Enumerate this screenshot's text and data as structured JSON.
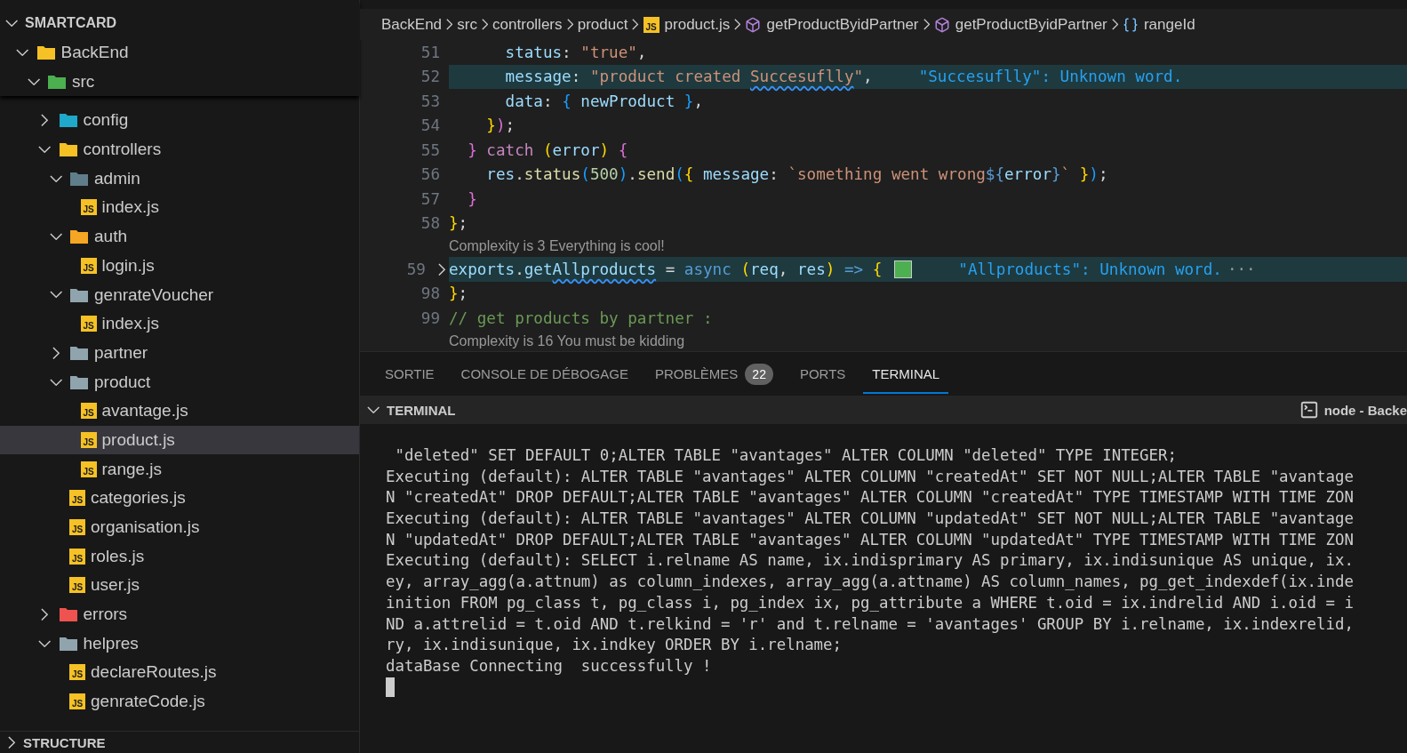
{
  "explorer": {
    "root": {
      "name": "SMARTCARD",
      "expanded": true,
      "children": [
        {
          "name": "BackEnd",
          "kind": "folder",
          "color": "#f5c125",
          "expanded": true,
          "children": [
            {
              "name": "src",
              "kind": "folder",
              "color": "#4caf50",
              "expanded": true,
              "children": [
                {
                  "name": "config",
                  "kind": "folder",
                  "color": "#1fa8c9",
                  "expanded": false,
                  "selected": false
                },
                {
                  "name": "controllers",
                  "kind": "folder",
                  "color": "#f5c125",
                  "expanded": true,
                  "selected": false,
                  "children": [
                    {
                      "name": "admin",
                      "kind": "folder",
                      "color": "#607d8b",
                      "expanded": true,
                      "selected": false,
                      "children": [
                        {
                          "name": "index.js",
                          "kind": "js",
                          "badge": "JS",
                          "selected": false
                        }
                      ]
                    },
                    {
                      "name": "auth",
                      "kind": "folder",
                      "color": "#f5a623",
                      "expanded": true,
                      "selected": false,
                      "children": [
                        {
                          "name": "login.js",
                          "kind": "js",
                          "badge": "JS",
                          "selected": false
                        }
                      ]
                    },
                    {
                      "name": "genrateVoucher",
                      "kind": "folder",
                      "color": "#90a4ae",
                      "expanded": true,
                      "selected": false,
                      "children": [
                        {
                          "name": "index.js",
                          "kind": "js",
                          "badge": "JS",
                          "selected": false
                        }
                      ]
                    },
                    {
                      "name": "partner",
                      "kind": "folder",
                      "color": "#90a4ae",
                      "expanded": false,
                      "selected": false
                    },
                    {
                      "name": "product",
                      "kind": "folder",
                      "color": "#90a4ae",
                      "expanded": true,
                      "selected": false,
                      "children": [
                        {
                          "name": "avantage.js",
                          "kind": "js",
                          "badge": "JS",
                          "selected": false
                        },
                        {
                          "name": "product.js",
                          "kind": "js",
                          "badge": "JS",
                          "selected": true
                        },
                        {
                          "name": "range.js",
                          "kind": "js",
                          "badge": "JS",
                          "selected": false
                        }
                      ]
                    },
                    {
                      "name": "categories.js",
                      "kind": "js",
                      "badge": "JS",
                      "selected": false
                    },
                    {
                      "name": "organisation.js",
                      "kind": "js",
                      "badge": "JS",
                      "selected": false
                    },
                    {
                      "name": "roles.js",
                      "kind": "js",
                      "badge": "JS",
                      "selected": false
                    },
                    {
                      "name": "user.js",
                      "kind": "js",
                      "badge": "JS",
                      "selected": false
                    }
                  ]
                },
                {
                  "name": "errors",
                  "kind": "folder",
                  "color": "#ef5350",
                  "expanded": false,
                  "selected": false
                },
                {
                  "name": "helpres",
                  "kind": "folder",
                  "color": "#90a4ae",
                  "expanded": true,
                  "selected": false,
                  "children": [
                    {
                      "name": "declareRoutes.js",
                      "kind": "js",
                      "badge": "JS",
                      "selected": false
                    },
                    {
                      "name": "genrateCode.js",
                      "kind": "js",
                      "badge": "JS",
                      "selected": false
                    }
                  ]
                }
              ]
            }
          ]
        }
      ]
    },
    "structure": {
      "title": "STRUCTURE",
      "expanded": false
    }
  },
  "breadcrumb": [
    {
      "label": "BackEnd",
      "kind": "text"
    },
    {
      "label": "src",
      "kind": "text"
    },
    {
      "label": "controllers",
      "kind": "text"
    },
    {
      "label": "product",
      "kind": "text"
    },
    {
      "label": "product.js",
      "kind": "file",
      "badge": "JS"
    },
    {
      "label": "getProductByidPartner",
      "kind": "method"
    },
    {
      "label": "getProductByidPartner",
      "kind": "method"
    },
    {
      "label": "rangeId",
      "kind": "variable"
    }
  ],
  "code": [
    {
      "kind": "code",
      "number": "51",
      "highlighted": false,
      "tokens": [
        {
          "t": "      status",
          "kind": "prop"
        },
        {
          "t": ": ",
          "kind": "plain"
        },
        {
          "t": "\"true\"",
          "kind": "str"
        },
        {
          "t": ",",
          "kind": "plain"
        }
      ]
    },
    {
      "kind": "code",
      "number": "52",
      "highlighted": true,
      "hint": "\"Succesuflly\": Unknown word.",
      "tokens": [
        {
          "t": "      message",
          "kind": "prop"
        },
        {
          "t": ": ",
          "kind": "plain"
        },
        {
          "t": "\"product created ",
          "kind": "str"
        },
        {
          "t": "Succesuflly",
          "kind": "str",
          "squiggle": true
        },
        {
          "t": "\"",
          "kind": "str"
        },
        {
          "t": ",",
          "kind": "plain"
        }
      ]
    },
    {
      "kind": "code",
      "number": "53",
      "highlighted": false,
      "tokens": [
        {
          "t": "      data",
          "kind": "prop"
        },
        {
          "t": ": ",
          "kind": "plain"
        },
        {
          "t": "{",
          "kind": "b3"
        },
        {
          "t": " newProduct ",
          "kind": "prop"
        },
        {
          "t": "}",
          "kind": "b3"
        },
        {
          "t": ",",
          "kind": "plain"
        }
      ]
    },
    {
      "kind": "code",
      "number": "54",
      "highlighted": false,
      "tokens": [
        {
          "t": "    }",
          "kind": "b1"
        },
        {
          "t": ")",
          "kind": "b2"
        },
        {
          "t": ";",
          "kind": "plain"
        }
      ]
    },
    {
      "kind": "code",
      "number": "55",
      "highlighted": false,
      "tokens": [
        {
          "t": "  }",
          "kind": "b2"
        },
        {
          "t": " catch ",
          "kind": "ctrl"
        },
        {
          "t": "(",
          "kind": "b1"
        },
        {
          "t": "error",
          "kind": "prop"
        },
        {
          "t": ") ",
          "kind": "b1"
        },
        {
          "t": "{",
          "kind": "b2"
        }
      ]
    },
    {
      "kind": "code",
      "number": "56",
      "highlighted": false,
      "tokens": [
        {
          "t": "    res",
          "kind": "prop"
        },
        {
          "t": ".",
          "kind": "plain"
        },
        {
          "t": "status",
          "kind": "func"
        },
        {
          "t": "(",
          "kind": "b3"
        },
        {
          "t": "500",
          "kind": "num"
        },
        {
          "t": ")",
          "kind": "b3"
        },
        {
          "t": ".",
          "kind": "plain"
        },
        {
          "t": "send",
          "kind": "func"
        },
        {
          "t": "(",
          "kind": "b3"
        },
        {
          "t": "{ ",
          "kind": "b1"
        },
        {
          "t": "message",
          "kind": "prop"
        },
        {
          "t": ": ",
          "kind": "plain"
        },
        {
          "t": "`something went wrong",
          "kind": "str"
        },
        {
          "t": "${",
          "kind": "kw"
        },
        {
          "t": "error",
          "kind": "prop"
        },
        {
          "t": "}",
          "kind": "kw"
        },
        {
          "t": "` ",
          "kind": "str"
        },
        {
          "t": "}",
          "kind": "b1"
        },
        {
          "t": ")",
          "kind": "b3"
        },
        {
          "t": ";",
          "kind": "plain"
        }
      ]
    },
    {
      "kind": "code",
      "number": "57",
      "highlighted": false,
      "tokens": [
        {
          "t": "  }",
          "kind": "b2"
        }
      ]
    },
    {
      "kind": "code",
      "number": "58",
      "highlighted": false,
      "tokens": [
        {
          "t": "}",
          "kind": "b1"
        },
        {
          "t": ";",
          "kind": "plain"
        }
      ]
    },
    {
      "kind": "lens",
      "text": "Complexity is 3 Everything is cool!"
    },
    {
      "kind": "code",
      "number": "59",
      "highlighted": true,
      "folded": true,
      "hint": "\"Allproducts\": Unknown word.",
      "more": "···",
      "tokens": [
        {
          "t": "exports",
          "kind": "prop"
        },
        {
          "t": ".",
          "kind": "plain"
        },
        {
          "t": "get",
          "kind": "prop"
        },
        {
          "t": "Allproducts",
          "kind": "prop",
          "squiggle": true
        },
        {
          "t": " = ",
          "kind": "plain"
        },
        {
          "t": "async ",
          "kind": "kw"
        },
        {
          "t": "(",
          "kind": "b1"
        },
        {
          "t": "req",
          "kind": "prop"
        },
        {
          "t": ", ",
          "kind": "plain"
        },
        {
          "t": "res",
          "kind": "prop"
        },
        {
          "t": ") ",
          "kind": "b1"
        },
        {
          "t": "=> ",
          "kind": "kw"
        },
        {
          "t": "{",
          "kind": "b1"
        }
      ]
    },
    {
      "kind": "code",
      "number": "98",
      "highlighted": false,
      "tokens": [
        {
          "t": "}",
          "kind": "b1"
        },
        {
          "t": ";",
          "kind": "plain"
        }
      ]
    },
    {
      "kind": "code",
      "number": "99",
      "highlighted": false,
      "tokens": [
        {
          "t": "// get products by partner :",
          "kind": "comment"
        }
      ]
    },
    {
      "kind": "lens",
      "text": "Complexity is 16 You must be kidding"
    }
  ],
  "panel": {
    "tabs": [
      {
        "label": "SORTIE",
        "selected": false
      },
      {
        "label": "CONSOLE DE DÉBOGAGE",
        "selected": false
      },
      {
        "label": "PROBLÈMES",
        "badge": "22",
        "selected": false
      },
      {
        "label": "PORTS",
        "selected": false
      },
      {
        "label": "TERMINAL",
        "selected": true
      }
    ],
    "section": {
      "title": "TERMINAL",
      "expanded": true,
      "session": "node - Backe"
    },
    "terminal": [
      " \"deleted\" SET DEFAULT 0;ALTER TABLE \"avantages\" ALTER COLUMN \"deleted\" TYPE INTEGER;",
      "Executing (default): ALTER TABLE \"avantages\" ALTER COLUMN \"createdAt\" SET NOT NULL;ALTER TABLE \"avantage",
      "N \"createdAt\" DROP DEFAULT;ALTER TABLE \"avantages\" ALTER COLUMN \"createdAt\" TYPE TIMESTAMP WITH TIME ZON",
      "Executing (default): ALTER TABLE \"avantages\" ALTER COLUMN \"updatedAt\" SET NOT NULL;ALTER TABLE \"avantage",
      "N \"updatedAt\" DROP DEFAULT;ALTER TABLE \"avantages\" ALTER COLUMN \"updatedAt\" TYPE TIMESTAMP WITH TIME ZON",
      "Executing (default): SELECT i.relname AS name, ix.indisprimary AS primary, ix.indisunique AS unique, ix.",
      "ey, array_agg(a.attnum) as column_indexes, array_agg(a.attname) AS column_names, pg_get_indexdef(ix.inde",
      "inition FROM pg_class t, pg_class i, pg_index ix, pg_attribute a WHERE t.oid = ix.indrelid AND i.oid = i",
      "ND a.attrelid = t.oid AND t.relkind = 'r' and t.relname = 'avantages' GROUP BY i.relname, ix.indexrelid,",
      "ry, ix.indisunique, ix.indkey ORDER BY i.relname;",
      "dataBase Connecting  successfully !"
    ]
  }
}
